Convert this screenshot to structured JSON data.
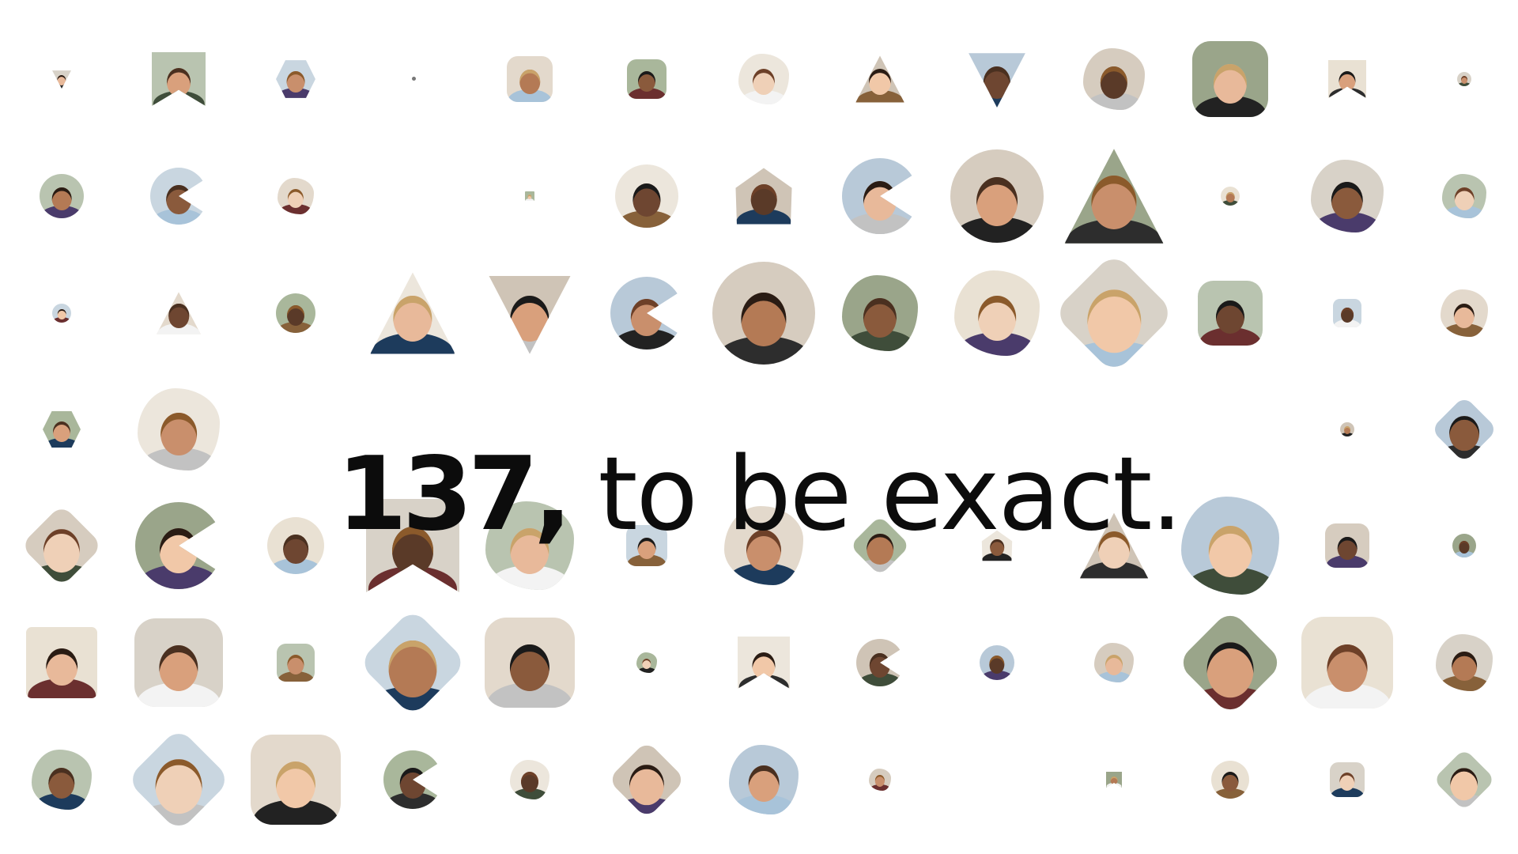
{
  "headline": {
    "number": "137,",
    "rest": " to be exact."
  },
  "colors": {
    "background": "#ffffff",
    "text": "#0c0c0c"
  },
  "avatars_icon": "person-avatar-icon"
}
